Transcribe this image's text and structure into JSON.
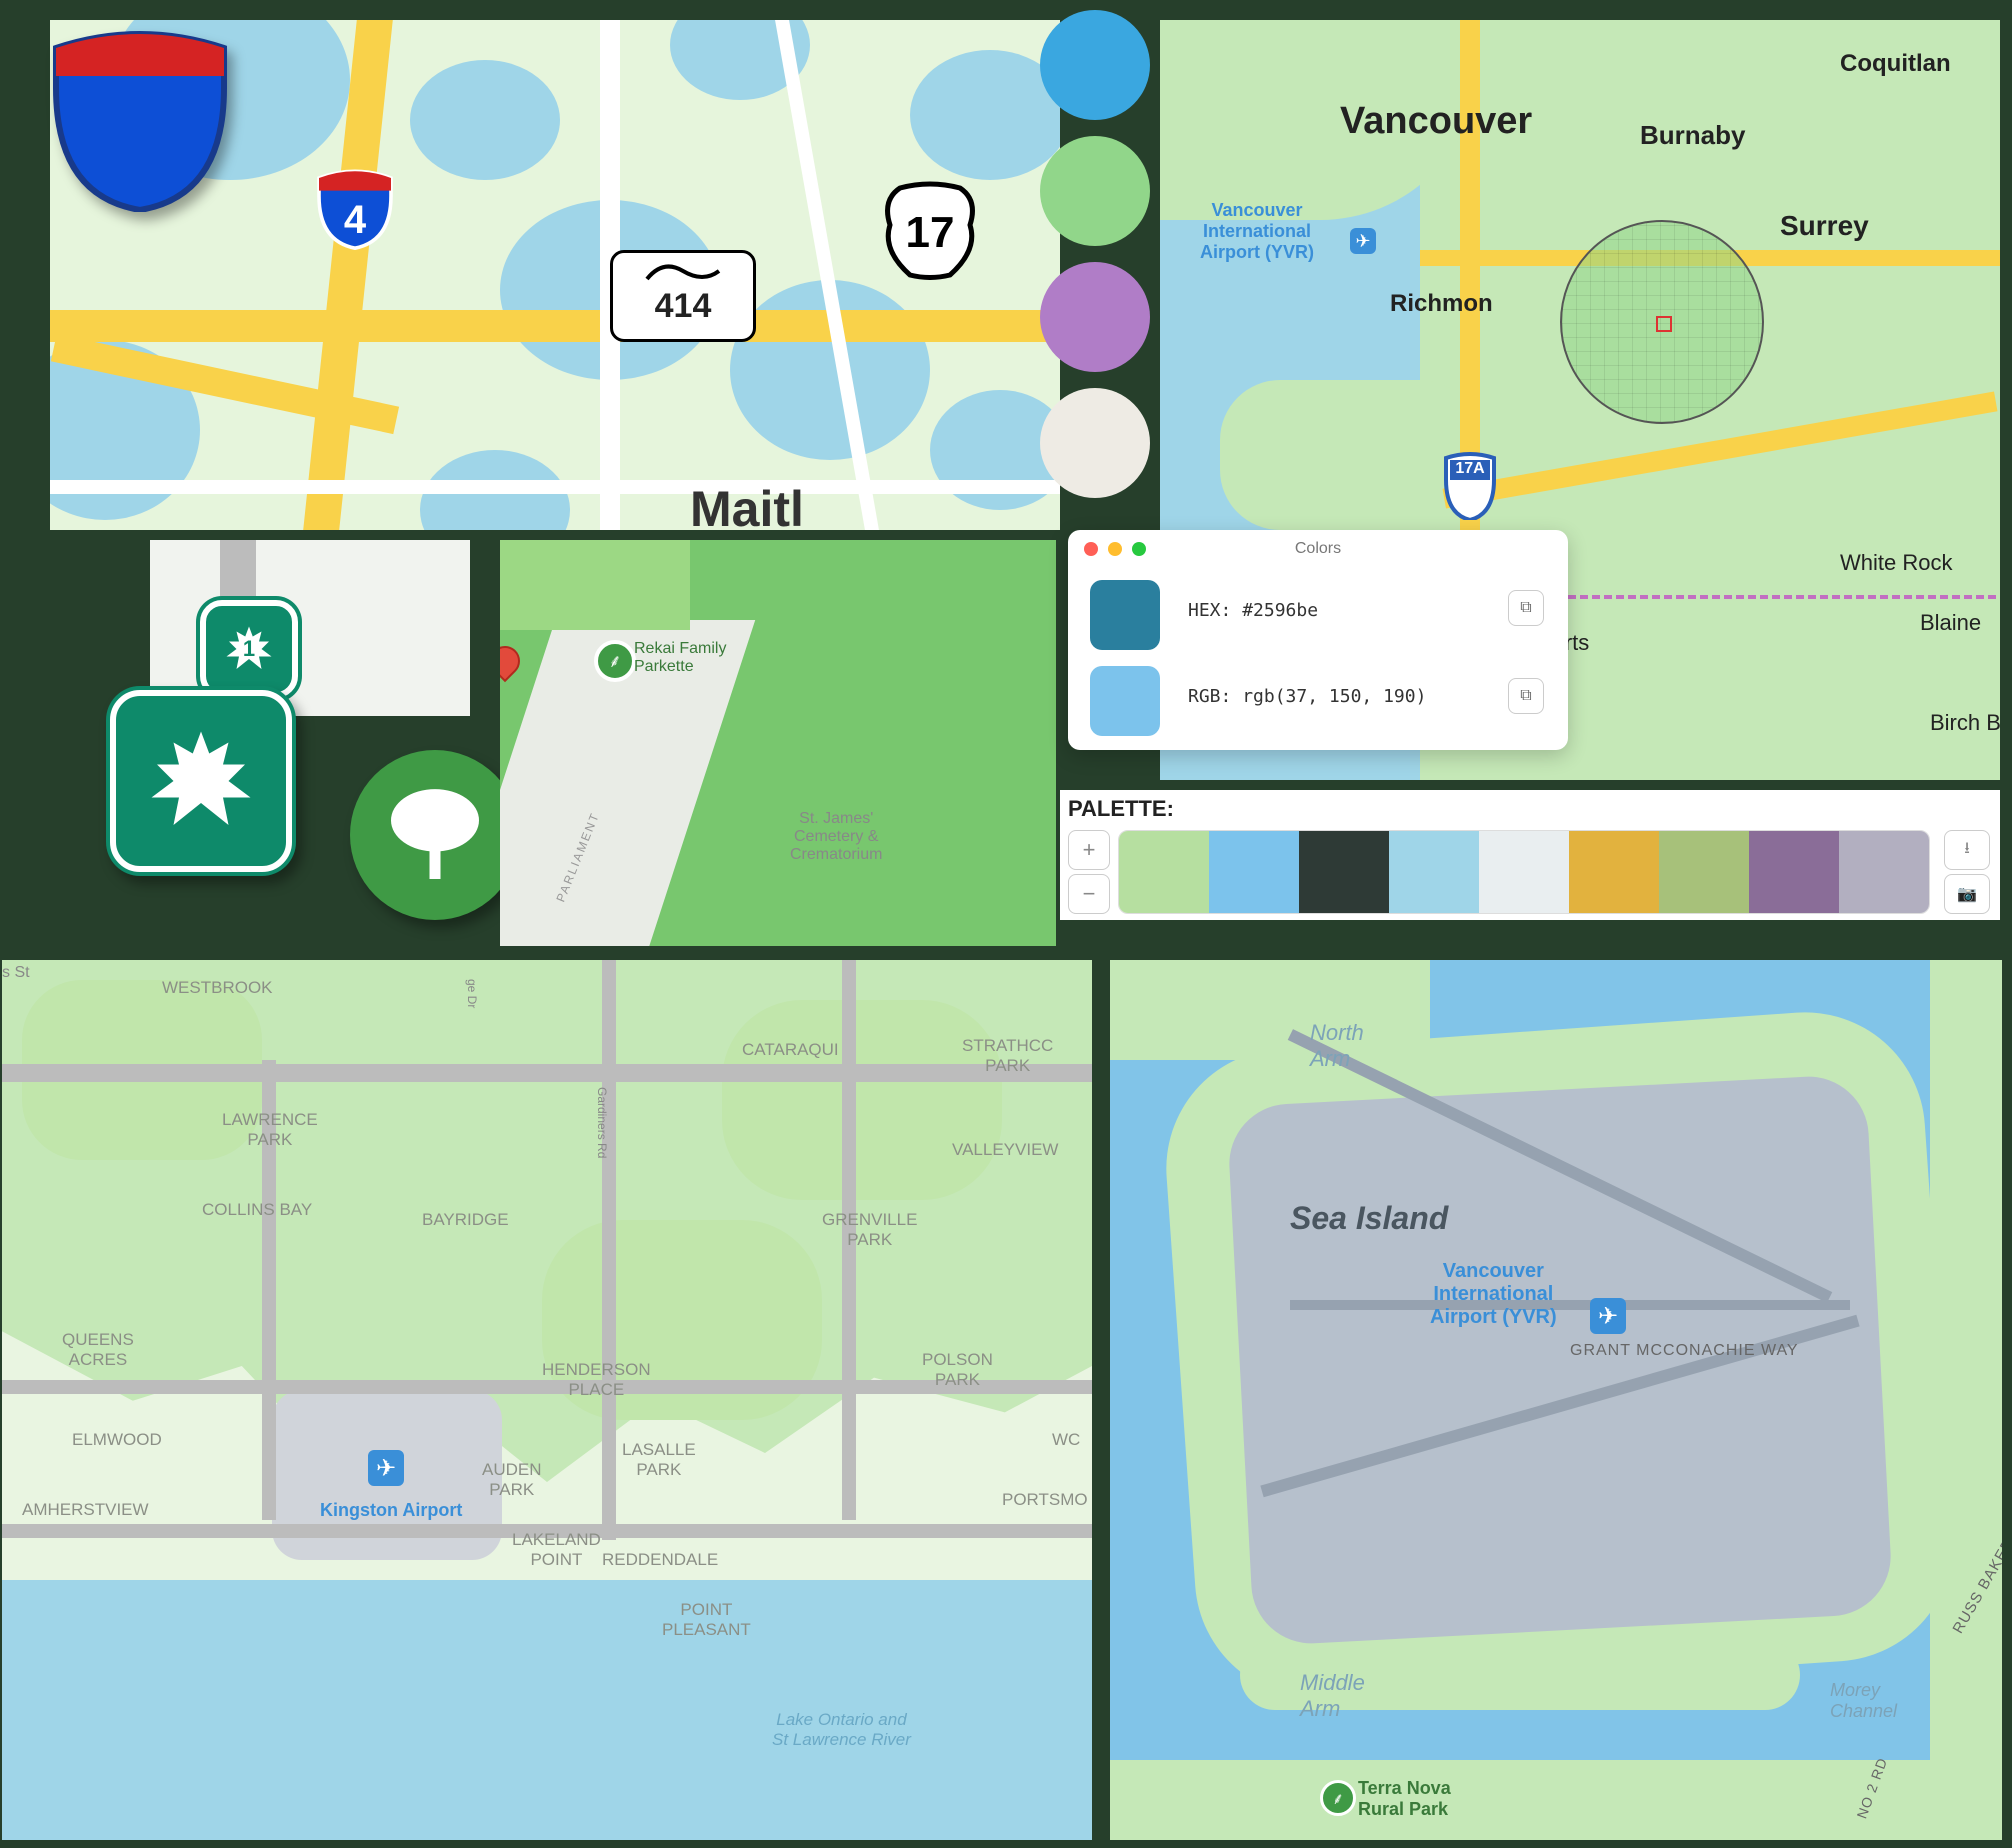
{
  "maitland": {
    "routes": {
      "i4": "4",
      "sr414": "414",
      "us17": "17"
    },
    "city": "Maitl"
  },
  "ontario_badge": {
    "route1": "1"
  },
  "toronto_park": {
    "park_name": "Rekai Family\nParkette",
    "cemetery": "St. James'\nCemetery &\nCrematorium",
    "street": "PARLIAMENT"
  },
  "vancouver": {
    "city": "Vancouver",
    "labels": [
      "Coquitlan",
      "Burnaby",
      "Surrey",
      "White Rock",
      "Blaine",
      "Birch B",
      "t Roberts"
    ],
    "airport": "Vancouver\nInternational\nAirport (YVR)",
    "richmond": "Richmon",
    "hwy": "17A"
  },
  "color_dots": [
    "#3aa7e0",
    "#91d68a",
    "#b07dc7",
    "#eeebe4"
  ],
  "colors_window": {
    "title": "Colors",
    "hex_label": "HEX:",
    "hex_value": "#2596be",
    "rgb_label": "RGB:",
    "rgb_value": "rgb(37, 150, 190)",
    "swatch1": "#2a7f9e",
    "swatch2": "#7cc3ec"
  },
  "palette": {
    "title": "PALETTE:",
    "colors": [
      "#b6dfa0",
      "#7cc3ec",
      "#2e3a36",
      "#9fd5e8",
      "#e9eef0",
      "#e2b23e",
      "#a7c17a",
      "#8a6d98",
      "#b2afc0"
    ]
  },
  "kingston": {
    "title_street": "s St",
    "areas": [
      "WESTBROOK",
      "CATARAQUI",
      "STRATHCC\nPARK",
      "LAWRENCE\nPARK",
      "VALLEYVIEW",
      "COLLINS BAY",
      "BAYRIDGE",
      "GRENVILLE\nPARK",
      "QUEENS\nACRES",
      "HENDERSON\nPLACE",
      "POLSON\nPARK",
      "ELMWOOD",
      "AUDEN\nPARK",
      "LASALLE\nPARK",
      "AMHERSTVIEW",
      "LAKELAND\nPOINT",
      "REDDENDALE",
      "POINT\nPLEASANT",
      "PORTSMO",
      "WC"
    ],
    "airport": "Kingston Airport",
    "lake": "Lake Ontario and\nSt Lawrence River",
    "roads": [
      "Gardiners Rd",
      "ge Dr"
    ]
  },
  "sea_island": {
    "island": "Sea Island",
    "north": "North\nArm",
    "middle": "Middle\nArm",
    "airport": "Vancouver\nInternational\nAirport (YVR)",
    "road1": "GRANT MCCONACHIE WAY",
    "road2": "RUSS BAKER WAY",
    "road3": "NO 2 RD",
    "park": "Terra Nova\nRural Park",
    "morey": "Morey\nChannel"
  }
}
